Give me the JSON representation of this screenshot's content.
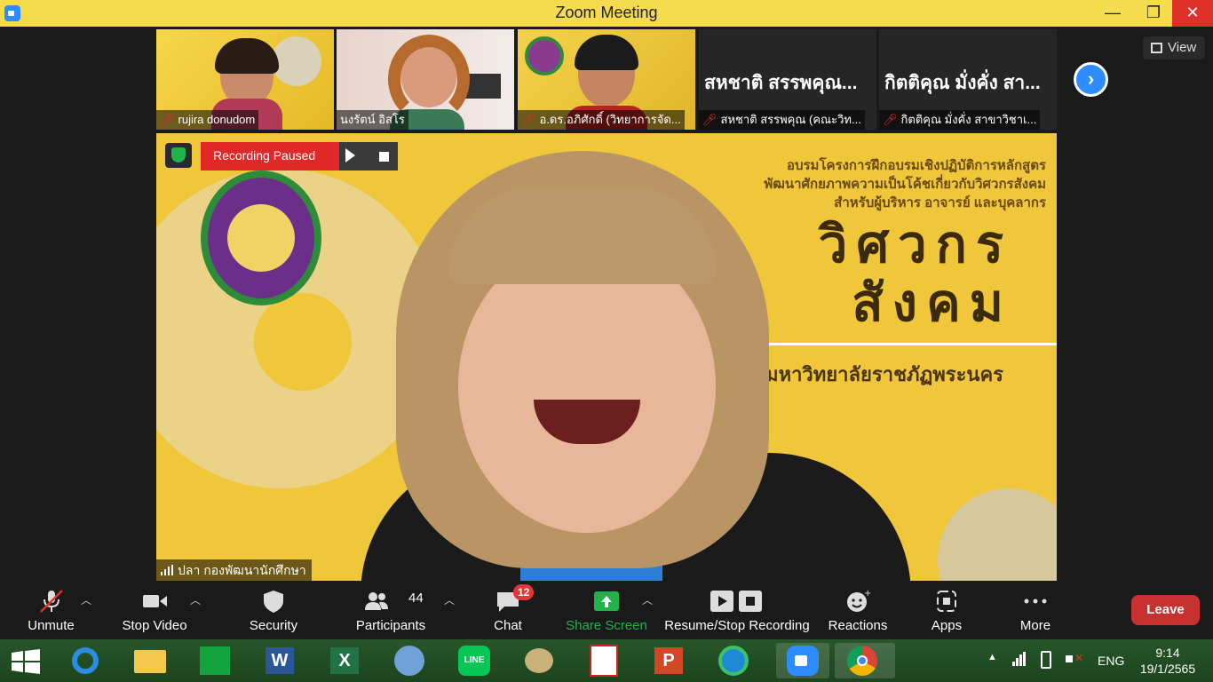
{
  "window": {
    "title": "Zoom Meeting",
    "minimize": "—",
    "maximize": "❐",
    "close": "✕"
  },
  "view_button": {
    "label": "View"
  },
  "thumbnails": [
    {
      "name": "rujira donudom",
      "video": true
    },
    {
      "name": "นงรัตน์ อิสโร",
      "video": true
    },
    {
      "name": "อ.ดร.อภิศักดิ์ (วิทยาการจัด...",
      "video": true
    },
    {
      "name": "สหชาติ สรรพคุณ (คณะวิท...",
      "display": "สหชาติ สรรพคุณ...",
      "video": false
    },
    {
      "name": "กิตติคุณ มั่งคั่ง สาขาวิชาเ...",
      "display": "กิตติคุณ  มั่งคั่ง สา...",
      "video": false
    }
  ],
  "next_page": "›",
  "recording": {
    "status": "Recording Paused"
  },
  "main_video": {
    "speaker_name": "ปลา กองพัฒนานักศึกษา",
    "banner_lines": [
      "อบรมโครงการฝึกอบรมเชิงปฏิบัติการหลักสูตร",
      "พัฒนาศักยภาพความเป็นโค้ชเกี่ยวกับวิศวกรสังคม",
      "สำหรับผู้บริหาร อาจารย์ และบุคลากร"
    ],
    "banner_big1": "วิศวกร",
    "banner_big2": "สังคม",
    "banner_univ": "มหาวิทยาลัยราชภัฏพระนคร"
  },
  "toolbar": {
    "unmute": "Unmute",
    "stop_video": "Stop Video",
    "security": "Security",
    "participants": "Participants",
    "participants_count": "44",
    "chat": "Chat",
    "chat_badge": "12",
    "share_screen": "Share Screen",
    "recording": "Resume/Stop Recording",
    "reactions": "Reactions",
    "apps": "Apps",
    "more": "More",
    "leave": "Leave"
  },
  "taskbar": {
    "language": "ENG",
    "time": "9:14",
    "date": "19/1/2565"
  },
  "colors": {
    "share_green": "#1fb34a",
    "leave_red": "#c73230",
    "accent_blue": "#2d8cff",
    "title_yellow": "#f5dc4e"
  }
}
